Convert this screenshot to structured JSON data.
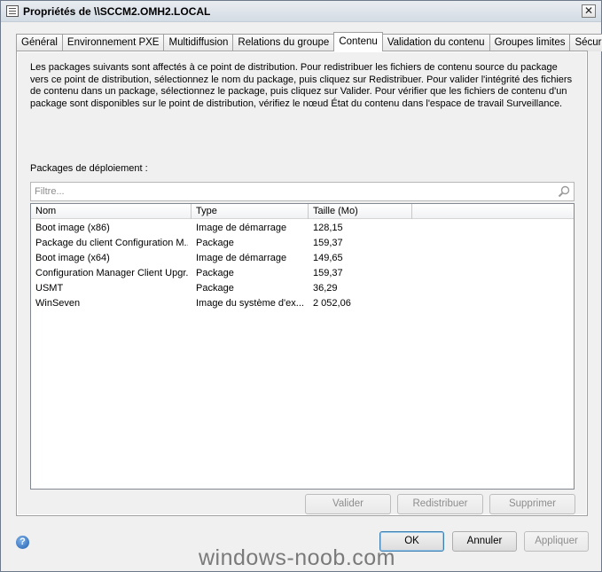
{
  "window": {
    "title": "Propriétés de \\\\SCCM2.OMH2.LOCAL",
    "close_glyph": "✕"
  },
  "tabs": [
    {
      "label": "Général"
    },
    {
      "label": "Environnement PXE"
    },
    {
      "label": "Multidiffusion"
    },
    {
      "label": "Relations du groupe"
    },
    {
      "label": "Contenu",
      "active": true
    },
    {
      "label": "Validation du contenu"
    },
    {
      "label": "Groupes limites"
    },
    {
      "label": "Sécurité"
    }
  ],
  "content": {
    "description": "Les packages suivants sont affectés à ce point de distribution. Pour redistribuer les fichiers de contenu source du package vers ce point de distribution, sélectionnez le nom du package, puis cliquez sur Redistribuer. Pour valider l'intégrité des fichiers de contenu dans un package, sélectionnez le package, puis cliquez sur Valider. Pour vérifier que les fichiers de contenu d'un package sont disponibles sur le point de distribution, vérifiez le nœud État du contenu dans l'espace de travail Surveillance.",
    "packages_label": "Packages de déploiement :",
    "filter": {
      "placeholder": "Filtre...",
      "icon": "search-icon"
    },
    "columns": [
      "Nom",
      "Type",
      "Taille (Mo)"
    ],
    "rows": [
      {
        "name": "Boot image (x86)",
        "type": "Image de démarrage",
        "size": "128,15"
      },
      {
        "name": "Package du client Configuration M...",
        "type": "Package",
        "size": "159,37"
      },
      {
        "name": "Boot image (x64)",
        "type": "Image de démarrage",
        "size": "149,65"
      },
      {
        "name": "Configuration Manager Client Upgr...",
        "type": "Package",
        "size": "159,37"
      },
      {
        "name": "USMT",
        "type": "Package",
        "size": "36,29"
      },
      {
        "name": "WinSeven",
        "type": "Image du système d'ex...",
        "size": "2 052,06"
      }
    ],
    "buttons": {
      "validate": "Valider",
      "redistribute": "Redistribuer",
      "remove": "Supprimer"
    }
  },
  "footer": {
    "help_glyph": "?",
    "ok": "OK",
    "cancel": "Annuler",
    "apply": "Appliquer"
  },
  "watermark": "windows-noob.com"
}
